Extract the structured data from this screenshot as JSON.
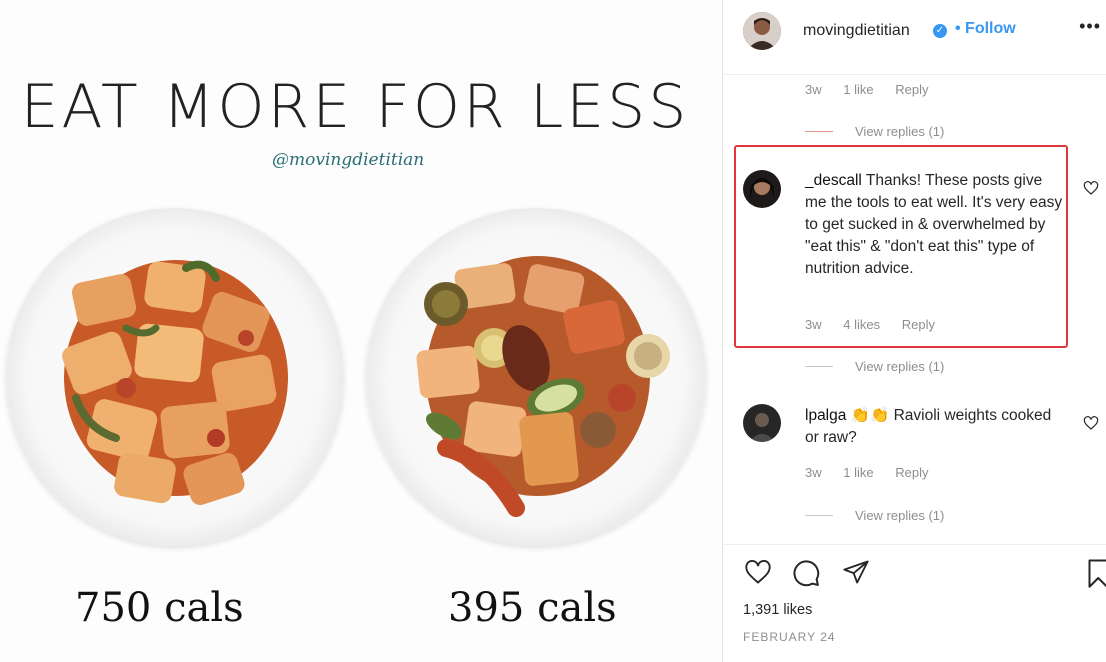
{
  "post": {
    "title": "EAT MORE FOR LESS",
    "handle": "@movingdietitian",
    "left_calories": "750 cals",
    "right_calories": "395 cals"
  },
  "header": {
    "username": "movingdietitian",
    "follow_label": "• Follow",
    "more_label": "•••"
  },
  "comments": [
    {
      "meta_time": "3w",
      "meta_likes": "1 like",
      "meta_reply": "Reply",
      "view_replies": "View replies (1)"
    },
    {
      "user": "_descall",
      "text": "Thanks! These posts give me the tools to eat well. It's very easy to get sucked in & overwhelmed by \"eat this\" & \"don't eat this\" type of nutrition advice.",
      "meta_time": "3w",
      "meta_likes": "4 likes",
      "meta_reply": "Reply",
      "view_replies": "View replies (1)"
    },
    {
      "user": "lpalga",
      "emoji": "👏👏",
      "text": "Ravioli weights cooked or raw?",
      "meta_time": "3w",
      "meta_likes": "1 like",
      "meta_reply": "Reply",
      "view_replies": "View replies (1)"
    }
  ],
  "footer": {
    "likes": "1,391 likes",
    "date": "FEBRUARY 24"
  },
  "icons": {
    "like": "heart-icon",
    "comment": "comment-icon",
    "share": "paper-plane-icon",
    "save": "bookmark-icon"
  },
  "colors": {
    "accent": "#3897f0",
    "highlight_box": "#e0353a",
    "handle": "#2a6f74"
  }
}
